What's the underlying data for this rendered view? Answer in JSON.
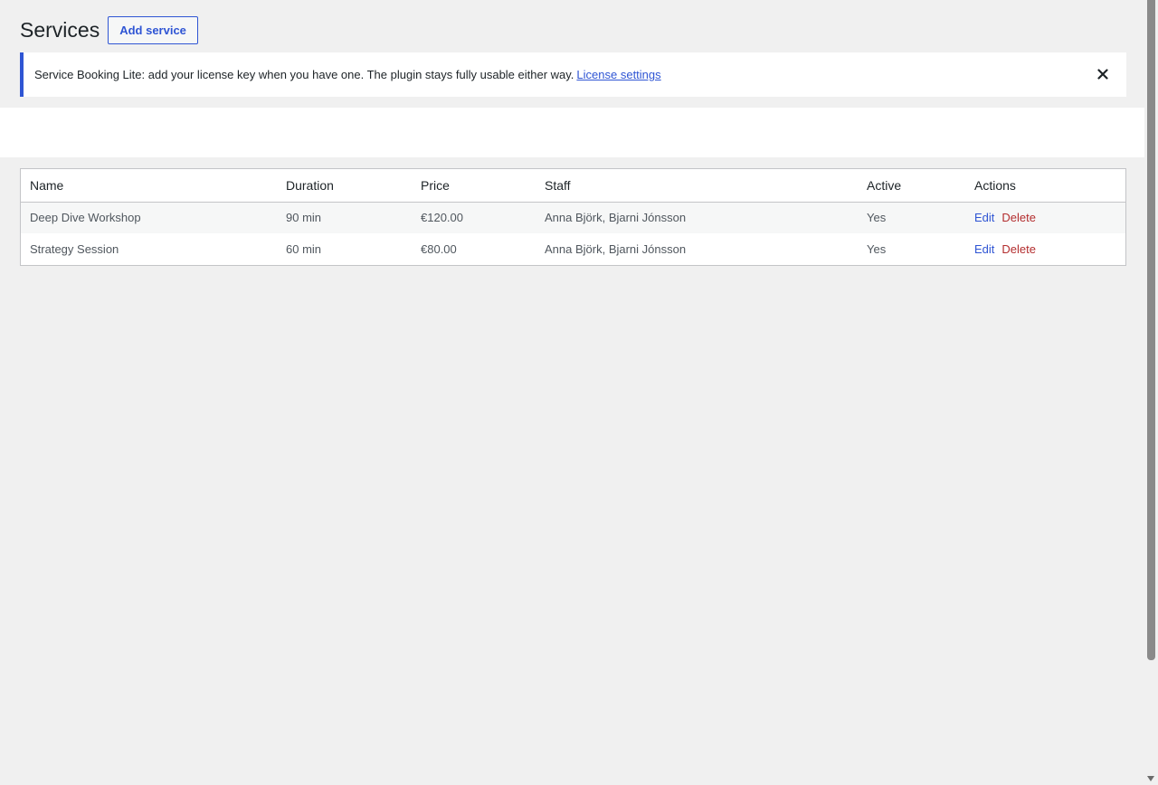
{
  "header": {
    "title": "Services",
    "add_button_label": "Add service"
  },
  "notice": {
    "message": "Service Booking Lite: add your license key when you have one. The plugin stays fully usable either way.",
    "link_label": "License settings",
    "dismiss_icon": "close-icon"
  },
  "table": {
    "columns": [
      "Name",
      "Duration",
      "Price",
      "Staff",
      "Active",
      "Actions"
    ],
    "rows": [
      {
        "name": "Deep Dive Workshop",
        "duration": "90 min",
        "price": "€120.00",
        "staff": "Anna Björk, Bjarni Jónsson",
        "active": "Yes",
        "edit_label": "Edit",
        "delete_label": "Delete"
      },
      {
        "name": "Strategy Session",
        "duration": "60 min",
        "price": "€80.00",
        "staff": "Anna Björk, Bjarni Jónsson",
        "active": "Yes",
        "edit_label": "Edit",
        "delete_label": "Delete"
      }
    ]
  },
  "colors": {
    "accent": "#2f55d4",
    "delete": "#b32d2e",
    "background": "#f0f0f0"
  }
}
